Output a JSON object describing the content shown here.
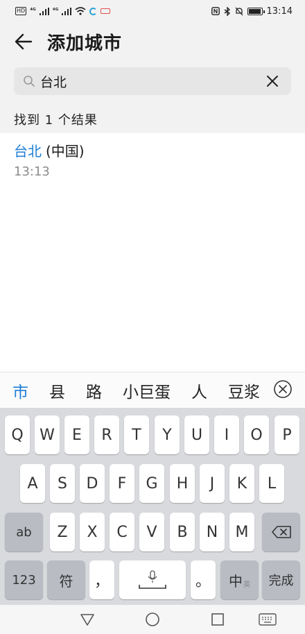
{
  "status_bar": {
    "left_chips": [
      "HD",
      "⁴ᴳ",
      "⁴ᴳ"
    ],
    "time": "13:14",
    "battery_level": 0.85
  },
  "header": {
    "title": "添加城市"
  },
  "search": {
    "value": "台北"
  },
  "results": {
    "count_text": "找到 1 个结果",
    "items": [
      {
        "city": "台北",
        "country": "(中国)",
        "time": "13:13"
      }
    ]
  },
  "candidates": [
    "市",
    "县",
    "路",
    "小巨蛋",
    "人",
    "豆浆"
  ],
  "keyboard": {
    "row1": [
      "Q",
      "W",
      "E",
      "R",
      "T",
      "Y",
      "U",
      "I",
      "O",
      "P"
    ],
    "row2": [
      "A",
      "S",
      "D",
      "F",
      "G",
      "H",
      "J",
      "K",
      "L"
    ],
    "row3": [
      "Z",
      "X",
      "C",
      "V",
      "B",
      "N",
      "M"
    ],
    "shift_label": "ab",
    "numbers_label": "123",
    "symbols_label": "符",
    "comma_label": "，",
    "period_label": "。",
    "lang_label": "中",
    "lang_sub_label": "英",
    "done_label": "完成"
  },
  "colors": {
    "accent": "#1e7ed6",
    "background": "#f2f2f2",
    "keyboard": "#d8dade"
  },
  "icons": {
    "back": "arrow-left-icon",
    "search": "search-icon",
    "clear": "close-icon",
    "candidate_close": "circle-close-icon",
    "backspace": "backspace-icon",
    "mic": "microphone-icon",
    "nav_back": "triangle-back-icon",
    "nav_home": "circle-home-icon",
    "nav_recents": "square-recents-icon",
    "nav_keyboard": "keyboard-icon"
  }
}
